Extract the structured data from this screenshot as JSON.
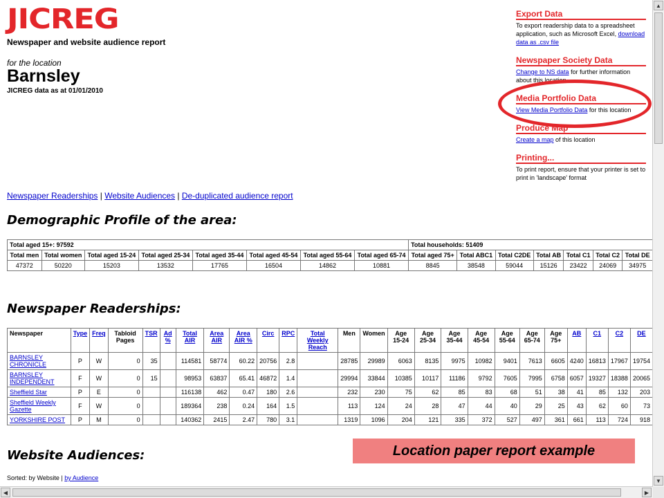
{
  "header": {
    "logo": "JICREG",
    "subtitle": "Newspaper and website audience report",
    "for_location": "for the location",
    "location": "Barnsley",
    "as_at": "JICREG data as at 01/01/2010"
  },
  "sidebar": {
    "export": {
      "title": "Export Data",
      "text": "To export readership data to a spreadsheet application, such as Microsoft Excel, ",
      "link": "download data as .csv file"
    },
    "ns": {
      "title": "Newspaper Society Data",
      "link": "Change to NS data",
      "text": " for further information about this location"
    },
    "media": {
      "title": "Media Portfolio Data",
      "link": "View Media Portfolio Data",
      "text": " for this location"
    },
    "map": {
      "title": "Produce Map",
      "link": "Create a map",
      "text": " of this location"
    },
    "print": {
      "title": "Printing...",
      "text": "To print report, ensure that your printer is set to print in 'landscape' format"
    }
  },
  "nav": {
    "links": [
      "Newspaper Readerships",
      "Website Audiences",
      "De-duplicated audience report"
    ],
    "sep": " | "
  },
  "demographic": {
    "heading": "Demographic Profile of the area:",
    "total15": "Total aged 15+: 97592",
    "households": "Total households: 51409",
    "headers": [
      "Total men",
      "Total women",
      "Total aged 15-24",
      "Total aged 25-34",
      "Total aged 35-44",
      "Total aged 45-54",
      "Total aged 55-64",
      "Total aged 65-74",
      "Total aged 75+",
      "Total ABC1",
      "Total C2DE",
      "Total AB",
      "Total C1",
      "Total C2",
      "Total DE"
    ],
    "values": [
      "47372",
      "50220",
      "15203",
      "13532",
      "17765",
      "16504",
      "14862",
      "10881",
      "8845",
      "38548",
      "59044",
      "15126",
      "23422",
      "24069",
      "34975"
    ]
  },
  "readership": {
    "heading": "Newspaper Readerships:",
    "headers": [
      "Newspaper",
      "Type",
      "Freq",
      "Tabloid Pages",
      "TSR",
      "Ad %",
      "Total AIR",
      "Area AIR",
      "Area AIR %",
      "Circ",
      "RPC",
      "Total Weekly Reach",
      "Men",
      "Women",
      "Age 15-24",
      "Age 25-34",
      "Age 35-44",
      "Age 45-54",
      "Age 55-64",
      "Age 65-74",
      "Age 75+",
      "AB",
      "C1",
      "C2",
      "DE"
    ],
    "rows": [
      [
        "BARNSLEY CHRONICLE",
        "P",
        "W",
        "0",
        "35",
        "",
        "114581",
        "58774",
        "60.22",
        "20756",
        "2.8",
        "",
        "28785",
        "29989",
        "6063",
        "8135",
        "9975",
        "10982",
        "9401",
        "7613",
        "6605",
        "4240",
        "16813",
        "17967",
        "19754"
      ],
      [
        "BARNSLEY INDEPENDENT",
        "F",
        "W",
        "0",
        "15",
        "",
        "98953",
        "63837",
        "65.41",
        "46872",
        "1.4",
        "",
        "29994",
        "33844",
        "10385",
        "10117",
        "11186",
        "9792",
        "7605",
        "7995",
        "6758",
        "6057",
        "19327",
        "18388",
        "20065"
      ],
      [
        "Sheffield Star",
        "P",
        "E",
        "0",
        "",
        "",
        "116138",
        "462",
        "0.47",
        "180",
        "2.6",
        "",
        "232",
        "230",
        "75",
        "62",
        "85",
        "83",
        "68",
        "51",
        "38",
        "41",
        "85",
        "132",
        "203"
      ],
      [
        "Sheffield Weekly Gazette",
        "F",
        "W",
        "0",
        "",
        "",
        "189364",
        "238",
        "0.24",
        "164",
        "1.5",
        "",
        "113",
        "124",
        "24",
        "28",
        "47",
        "44",
        "40",
        "29",
        "25",
        "43",
        "62",
        "60",
        "73"
      ],
      [
        "YORKSHIRE POST",
        "P",
        "M",
        "0",
        "",
        "",
        "140362",
        "2415",
        "2.47",
        "780",
        "3.1",
        "",
        "1319",
        "1096",
        "204",
        "121",
        "335",
        "372",
        "527",
        "497",
        "361",
        "661",
        "113",
        "724",
        "918"
      ]
    ]
  },
  "website": {
    "heading": "Website Audiences:",
    "sorted_label": "Sorted: by Website | ",
    "sorted_link": "by Audience"
  },
  "banner": "Location paper report example"
}
